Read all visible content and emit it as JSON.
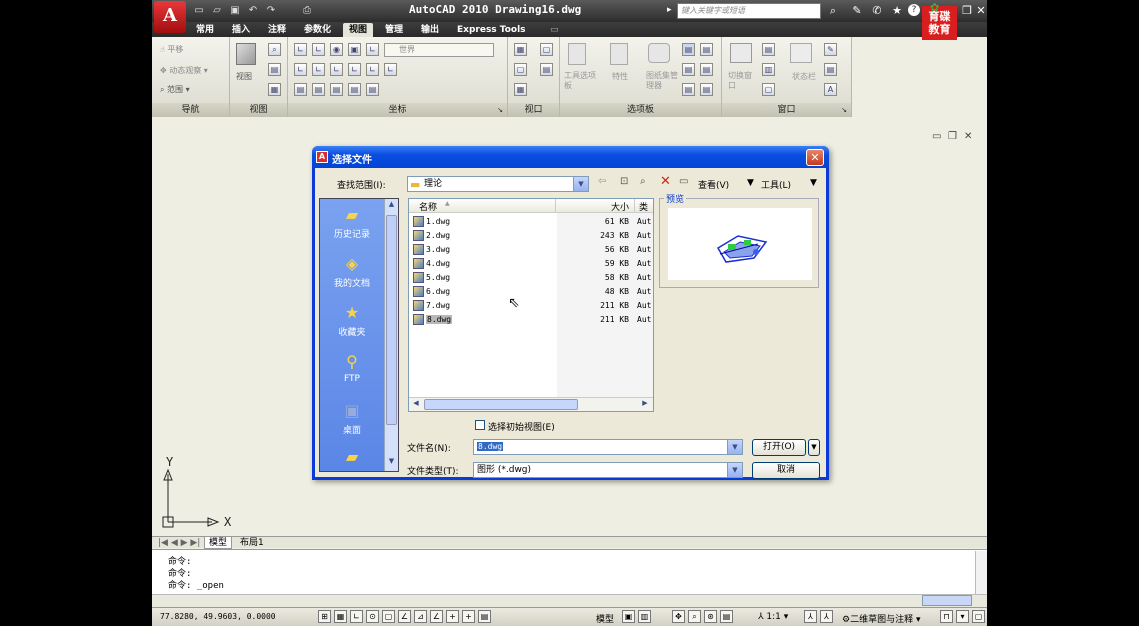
{
  "app": {
    "logo": "A",
    "title": "AutoCAD 2010  Drawing16.dwg",
    "search_placeholder": "键入关键字或短语",
    "brand": "育碟教育"
  },
  "tabs": [
    "常用",
    "插入",
    "注释",
    "参数化",
    "视图",
    "管理",
    "输出",
    "Express Tools"
  ],
  "active_tab": "视图",
  "ribbon": {
    "panels": [
      "导航",
      "视图",
      "坐标",
      "视口",
      "选项板",
      "窗口"
    ],
    "nav_items": [
      "平移",
      "动态观察",
      "范围"
    ],
    "view_label": "视图",
    "ucs_world": "世界",
    "palette_items": [
      "工具选项板",
      "特性",
      "图纸集管理器"
    ],
    "window_items": [
      "切换窗口",
      "状态栏"
    ]
  },
  "ucs": {
    "x": "X",
    "y": "Y"
  },
  "layout_tabs": [
    "模型",
    "布局1"
  ],
  "command_lines": [
    "命令:",
    "命令:",
    "命令: _open"
  ],
  "status": {
    "coords": "77.8280, 49.9603, 0.0000",
    "model": "模型",
    "scale": "1:1",
    "workspace": "二维草图与注释"
  },
  "dialog": {
    "title": "选择文件",
    "lookin_label": "查找范围(I):",
    "lookin_value": "理论",
    "view_menu": "查看(V)",
    "tools_menu": "工具(L)",
    "places": [
      "历史记录",
      "我的文档",
      "收藏夹",
      "FTP",
      "桌面"
    ],
    "columns": [
      "名称",
      "大小",
      "类"
    ],
    "files": [
      {
        "name": "1.dwg",
        "size": "61 KB",
        "type": "Aut"
      },
      {
        "name": "2.dwg",
        "size": "243 KB",
        "type": "Aut"
      },
      {
        "name": "3.dwg",
        "size": "56 KB",
        "type": "Aut"
      },
      {
        "name": "4.dwg",
        "size": "59 KB",
        "type": "Aut"
      },
      {
        "name": "5.dwg",
        "size": "58 KB",
        "type": "Aut"
      },
      {
        "name": "6.dwg",
        "size": "48 KB",
        "type": "Aut"
      },
      {
        "name": "7.dwg",
        "size": "211 KB",
        "type": "Aut"
      },
      {
        "name": "8.dwg",
        "size": "211 KB",
        "type": "Aut"
      }
    ],
    "preview_label": "预览",
    "initial_view_label": "选择初始视图(E)",
    "filename_label": "文件名(N):",
    "filename_value": "8.dwg",
    "filetype_label": "文件类型(T):",
    "filetype_value": "图形 (*.dwg)",
    "open_button": "打开(O)",
    "cancel_button": "取消"
  }
}
